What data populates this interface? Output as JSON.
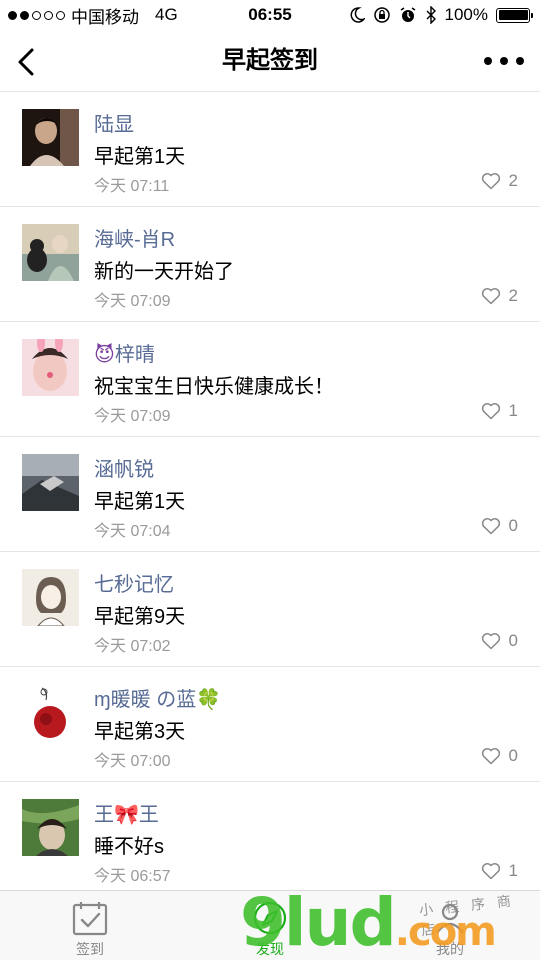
{
  "status_bar": {
    "carrier": "中国移动",
    "network": "4G",
    "time": "06:55",
    "battery": "100%"
  },
  "nav": {
    "title": "早起签到"
  },
  "feed": [
    {
      "nickname": "陆显",
      "message": "早起第1天",
      "time": "今天 07:11",
      "likes": "2",
      "avatar_colors": [
        "#2b1b14",
        "#c9a58a"
      ]
    },
    {
      "nickname": "海峡-肖R",
      "message": "新的一天开始了",
      "time": "今天 07:09",
      "likes": "2",
      "avatar_colors": [
        "#8fa39a",
        "#e7d6c3"
      ]
    },
    {
      "nickname_emoji": "😈",
      "nickname": "梓晴",
      "message": "祝宝宝生日快乐健康成长！",
      "time": "今天 07:09",
      "likes": "1",
      "avatar_colors": [
        "#f4c9cf",
        "#e6a2ad"
      ]
    },
    {
      "nickname": "涵帆锐",
      "message": "早起第1天",
      "time": "今天 07:04",
      "likes": "0",
      "avatar_colors": [
        "#4a5058",
        "#a7aeb5"
      ]
    },
    {
      "nickname": "七秒记忆",
      "message": "早起第9天",
      "time": "今天 07:02",
      "likes": "0",
      "avatar_colors": [
        "#f1ece4",
        "#6b5d52"
      ]
    },
    {
      "nickname": "ɱ暖暖 の蓝",
      "nickname_emoji": "🍀",
      "message": "早起第3天",
      "time": "今天 07:00",
      "likes": "0",
      "avatar_colors": [
        "#ffffff",
        "#b8191f"
      ]
    },
    {
      "nickname": "王🎀王",
      "message": "睡不好s",
      "time": "今天 06:57",
      "likes": "1",
      "avatar_colors": [
        "#4e7a3a",
        "#d9c7b0"
      ]
    }
  ],
  "tabs": [
    {
      "label": "签到",
      "icon": "calendar-check-icon",
      "active": false
    },
    {
      "label": "发现",
      "icon": "compass-icon",
      "active": true
    },
    {
      "label": "我的",
      "icon": "person-icon",
      "active": false
    }
  ],
  "watermark": {
    "brand": "9lud.com",
    "slogan": "小程序商店"
  },
  "colors": {
    "nickname": "#576b95",
    "active_tab": "#1aad19",
    "watermark_green": "#3dbf2b",
    "watermark_orange": "#f39a1e"
  }
}
